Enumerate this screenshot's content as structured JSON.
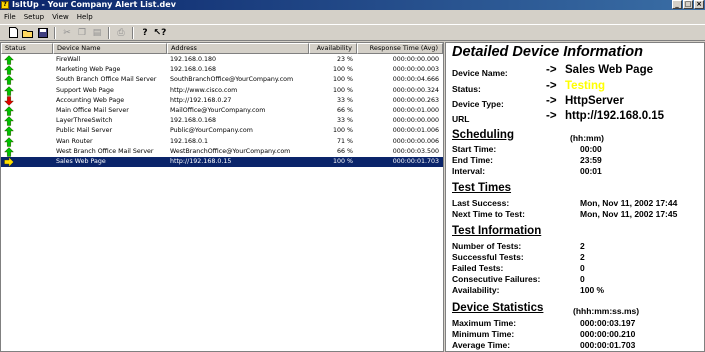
{
  "window": {
    "title": "IsItUp - Your Company Alert List.dev",
    "icon": "app-icon"
  },
  "menu": [
    "File",
    "Setup",
    "View",
    "Help"
  ],
  "toolbar": {
    "tools": [
      "new-icon",
      "open-icon",
      "save-icon",
      "cut-icon",
      "copy-icon",
      "paste-icon",
      "print-icon",
      "help-icon",
      "context-help-icon"
    ]
  },
  "list": {
    "columns": [
      "Status",
      "Device Name",
      "Address",
      "Availability",
      "Response Time (Avg)"
    ],
    "rows": [
      {
        "status": "up",
        "name": "FireWall",
        "address": "192.168.0.180",
        "availability": "23 %",
        "response": "000:00:00.000"
      },
      {
        "status": "up",
        "name": "Marketing Web Page",
        "address": "192.168.0.168",
        "availability": "100 %",
        "response": "000:00:00.003"
      },
      {
        "status": "up",
        "name": "South Branch Office Mail Server",
        "address": "SouthBranchOffice@YourCompany.com",
        "availability": "100 %",
        "response": "000:00:04.666"
      },
      {
        "status": "up",
        "name": "Support Web Page",
        "address": "http://www.cisco.com",
        "availability": "100 %",
        "response": "000:00:00.324"
      },
      {
        "status": "down",
        "name": "Accounting Web Page",
        "address": "http://192.168.0.27",
        "availability": "33 %",
        "response": "000:00:00.263"
      },
      {
        "status": "up",
        "name": "Main Office Mail Server",
        "address": "MailOffice@YourCompany.com",
        "availability": "66 %",
        "response": "000:00:01.000"
      },
      {
        "status": "up",
        "name": "LayerThreeSwitch",
        "address": "192.168.0.168",
        "availability": "33 %",
        "response": "000:00:00.000"
      },
      {
        "status": "up",
        "name": "Public Mail Server",
        "address": "Public@YourCompany.com",
        "availability": "100 %",
        "response": "000:00:01.006"
      },
      {
        "status": "up",
        "name": "Wan Router",
        "address": "192.168.0.1",
        "availability": "71 %",
        "response": "000:00:00.006"
      },
      {
        "status": "up",
        "name": "West Branch Office Mail Server",
        "address": "WestBranchOffice@YourCompany.com",
        "availability": "66 %",
        "response": "000:00:03.500"
      },
      {
        "status": "testing",
        "name": "Sales Web Page",
        "address": "http://192.168.0.15",
        "availability": "100 %",
        "response": "000:00:01.703",
        "selected": true
      }
    ]
  },
  "detail": {
    "title": "Detailed Device Information",
    "device": [
      {
        "label": "Device Name:",
        "arrow": "->",
        "value": "Sales Web Page"
      },
      {
        "label": "Status:",
        "arrow": "->",
        "value": "Testing",
        "color": "#ffff00"
      },
      {
        "label": "Device Type:",
        "arrow": "->",
        "value": "HttpServer"
      },
      {
        "label": "URL",
        "arrow": "->",
        "value": "http://192.168.0.15"
      }
    ],
    "scheduling": {
      "title": "Scheduling",
      "unit": "(hh:mm)",
      "items": [
        {
          "label": "Start Time:",
          "value": "00:00"
        },
        {
          "label": "End Time:",
          "value": "23:59"
        },
        {
          "label": "Interval:",
          "value": "00:01"
        }
      ]
    },
    "test_times": {
      "title": "Test Times",
      "items": [
        {
          "label": "Last Success:",
          "value": "Mon, Nov 11, 2002 17:44"
        },
        {
          "label": "Next Time to Test:",
          "value": "Mon, Nov 11, 2002 17:45"
        }
      ]
    },
    "test_info": {
      "title": "Test Information",
      "items": [
        {
          "label": "Number of Tests:",
          "value": "2"
        },
        {
          "label": "Successful Tests:",
          "value": "2"
        },
        {
          "label": "Failed Tests:",
          "value": "0"
        },
        {
          "label": "Consecutive Failures:",
          "value": "0"
        },
        {
          "label": "Availability:",
          "value": "100 %"
        }
      ]
    },
    "stats": {
      "title": "Device Statistics",
      "unit": "(hhh:mm:ss.ms)",
      "items": [
        {
          "label": "Maximum Time:",
          "value": "000:00:03.197"
        },
        {
          "label": "Minimum Time:",
          "value": "000:00:00.210"
        },
        {
          "label": "Average Time:",
          "value": "000:00:01.703"
        }
      ]
    }
  },
  "colors": {
    "up": "#00c000",
    "down": "#e00000",
    "testing": "#ffe000",
    "selection": "#0a246a",
    "status_value": "#ffff00"
  }
}
